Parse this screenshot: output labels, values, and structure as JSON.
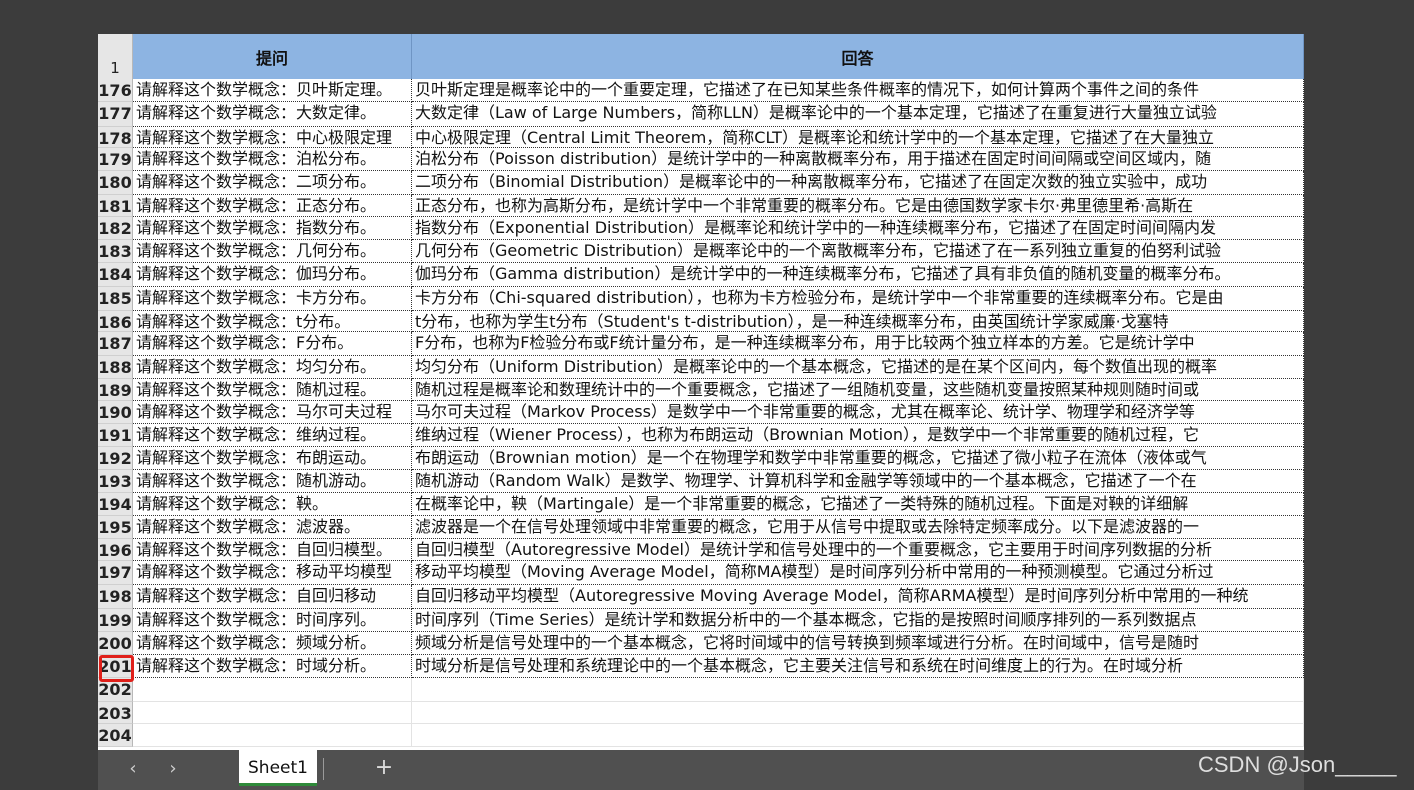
{
  "header": {
    "row_number": "1",
    "col_question": "提问",
    "col_answer": "回答"
  },
  "rows": [
    {
      "n": "176",
      "q": "请解释这个数学概念：贝叶斯定理。",
      "a": "贝叶斯定理是概率论中的一个重要定理，它描述了在已知某些条件概率的情况下，如何计算两个事件之间的条件"
    },
    {
      "n": "177",
      "q": "请解释这个数学概念：大数定律。",
      "a": "大数定律（Law of Large Numbers，简称LLN）是概率论中的一个基本定理，它描述了在重复进行大量独立试验"
    },
    {
      "n": "178",
      "q": "请解释这个数学概念：中心极限定理",
      "a": "中心极限定理（Central Limit Theorem，简称CLT）是概率论和统计学中的一个基本定理，它描述了在大量独立"
    },
    {
      "n": "179",
      "q": "请解释这个数学概念：泊松分布。",
      "a": "泊松分布（Poisson distribution）是统计学中的一种离散概率分布，用于描述在固定时间间隔或空间区域内，随"
    },
    {
      "n": "180",
      "q": "请解释这个数学概念：二项分布。",
      "a": "二项分布（Binomial Distribution）是概率论中的一种离散概率分布，它描述了在固定次数的独立实验中，成功"
    },
    {
      "n": "181",
      "q": "请解释这个数学概念：正态分布。",
      "a": "正态分布，也称为高斯分布，是统计学中一个非常重要的概率分布。它是由德国数学家卡尔·弗里德里希·高斯在"
    },
    {
      "n": "182",
      "q": "请解释这个数学概念：指数分布。",
      "a": "指数分布（Exponential Distribution）是概率论和统计学中的一种连续概率分布，它描述了在固定时间间隔内发"
    },
    {
      "n": "183",
      "q": "请解释这个数学概念：几何分布。",
      "a": "几何分布（Geometric Distribution）是概率论中的一个离散概率分布，它描述了在一系列独立重复的伯努利试验"
    },
    {
      "n": "184",
      "q": "请解释这个数学概念：伽玛分布。",
      "a": "伽玛分布（Gamma distribution）是统计学中的一种连续概率分布，它描述了具有非负值的随机变量的概率分布。"
    },
    {
      "n": "185",
      "q": "请解释这个数学概念：卡方分布。",
      "a": "卡方分布（Chi-squared distribution），也称为卡方检验分布，是统计学中一个非常重要的连续概率分布。它是由"
    },
    {
      "n": "186",
      "q": "请解释这个数学概念：t分布。",
      "a": "t分布，也称为学生t分布（Student's t-distribution），是一种连续概率分布，由英国统计学家威廉·戈塞特"
    },
    {
      "n": "187",
      "q": "请解释这个数学概念：F分布。",
      "a": "F分布，也称为F检验分布或F统计量分布，是一种连续概率分布，用于比较两个独立样本的方差。它是统计学中"
    },
    {
      "n": "188",
      "q": "请解释这个数学概念：均匀分布。",
      "a": "均匀分布（Uniform Distribution）是概率论中的一个基本概念，它描述的是在某个区间内，每个数值出现的概率"
    },
    {
      "n": "189",
      "q": "请解释这个数学概念：随机过程。",
      "a": "随机过程是概率论和数理统计中的一个重要概念，它描述了一组随机变量，这些随机变量按照某种规则随时间或"
    },
    {
      "n": "190",
      "q": "请解释这个数学概念：马尔可夫过程",
      "a": "马尔可夫过程（Markov Process）是数学中一个非常重要的概念，尤其在概率论、统计学、物理学和经济学等"
    },
    {
      "n": "191",
      "q": "请解释这个数学概念：维纳过程。",
      "a": "维纳过程（Wiener Process），也称为布朗运动（Brownian Motion），是数学中一个非常重要的随机过程，它"
    },
    {
      "n": "192",
      "q": "请解释这个数学概念：布朗运动。",
      "a": "布朗运动（Brownian motion）是一个在物理学和数学中非常重要的概念，它描述了微小粒子在流体（液体或气"
    },
    {
      "n": "193",
      "q": "请解释这个数学概念：随机游动。",
      "a": "随机游动（Random Walk）是数学、物理学、计算机科学和金融学等领域中的一个基本概念，它描述了一个在"
    },
    {
      "n": "194",
      "q": "请解释这个数学概念：鞅。",
      "a": "在概率论中，鞅（Martingale）是一个非常重要的概念，它描述了一类特殊的随机过程。下面是对鞅的详细解"
    },
    {
      "n": "195",
      "q": "请解释这个数学概念：滤波器。",
      "a": "滤波器是一个在信号处理领域中非常重要的概念，它用于从信号中提取或去除特定频率成分。以下是滤波器的一"
    },
    {
      "n": "196",
      "q": "请解释这个数学概念：自回归模型。",
      "a": "自回归模型（Autoregressive Model）是统计学和信号处理中的一个重要概念，它主要用于时间序列数据的分析"
    },
    {
      "n": "197",
      "q": "请解释这个数学概念：移动平均模型",
      "a": "移动平均模型（Moving Average Model，简称MA模型）是时间序列分析中常用的一种预测模型。它通过分析过"
    },
    {
      "n": "198",
      "q": "请解释这个数学概念：自回归移动",
      "a": "自回归移动平均模型（Autoregressive Moving Average Model，简称ARMA模型）是时间序列分析中常用的一种统"
    },
    {
      "n": "199",
      "q": "请解释这个数学概念：时间序列。",
      "a": "时间序列（Time Series）是统计学和数据分析中的一个基本概念，它指的是按照时间顺序排列的一系列数据点"
    },
    {
      "n": "200",
      "q": "请解释这个数学概念：频域分析。",
      "a": "频域分析是信号处理中的一个基本概念，它将时间域中的信号转换到频率域进行分析。在时间域中，信号是随时"
    },
    {
      "n": "201",
      "q": "请解释这个数学概念：时域分析。",
      "a": "时域分析是信号处理和系统理论中的一个基本概念，它主要关注信号和系统在时间维度上的行为。在时域分析"
    },
    {
      "n": "202",
      "q": "",
      "a": ""
    },
    {
      "n": "203",
      "q": "",
      "a": ""
    },
    {
      "n": "204",
      "q": "",
      "a": ""
    }
  ],
  "tabbar": {
    "prev_icon": "‹",
    "next_icon": "›",
    "sheet_tab": "Sheet1",
    "add_icon": "+"
  },
  "watermark": "CSDN @Json_____"
}
